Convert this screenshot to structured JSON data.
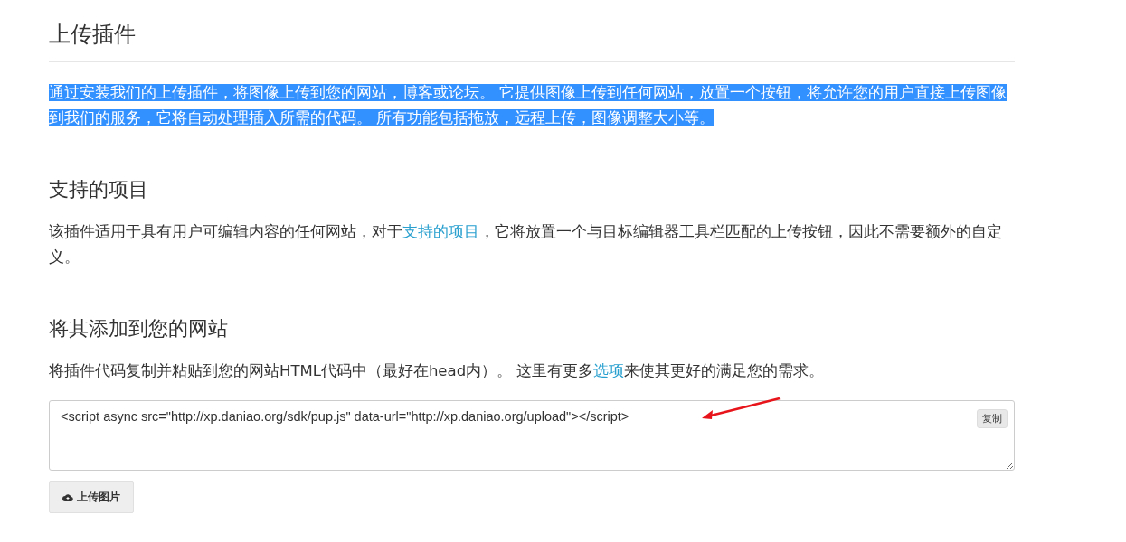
{
  "title": "上传插件",
  "intro": {
    "text": "通过安装我们的上传插件，将图像上传到您的网站，博客或论坛。 它提供图像上传到任何网站，放置一个按钮，将允许您的用户直接上传图像到我们的服务，它将自动处理插入所需的代码。 所有功能包括拖放，远程上传，图像调整大小等。",
    "selected": true
  },
  "sections": [
    {
      "heading": "支持的项目",
      "before": "该插件适用于具有用户可编辑内容的任何网站，对于",
      "link": "支持的项目",
      "after": "，它将放置一个与目标编辑器工具栏匹配的上传按钮，因此不需要额外的自定义。"
    },
    {
      "heading": "将其添加到您的网站",
      "before": "将插件代码复制并粘贴到您的网站HTML代码中（最好在head内）。 这里有更多",
      "link": "选项",
      "after": "来使其更好的满足您的需求。"
    }
  ],
  "code": {
    "value": "<script async src=\"http://xp.daniao.org/sdk/pup.js\" data-url=\"http://xp.daniao.org/upload\"></script>",
    "copy_label": "复制"
  },
  "upload_button": "上传图片"
}
